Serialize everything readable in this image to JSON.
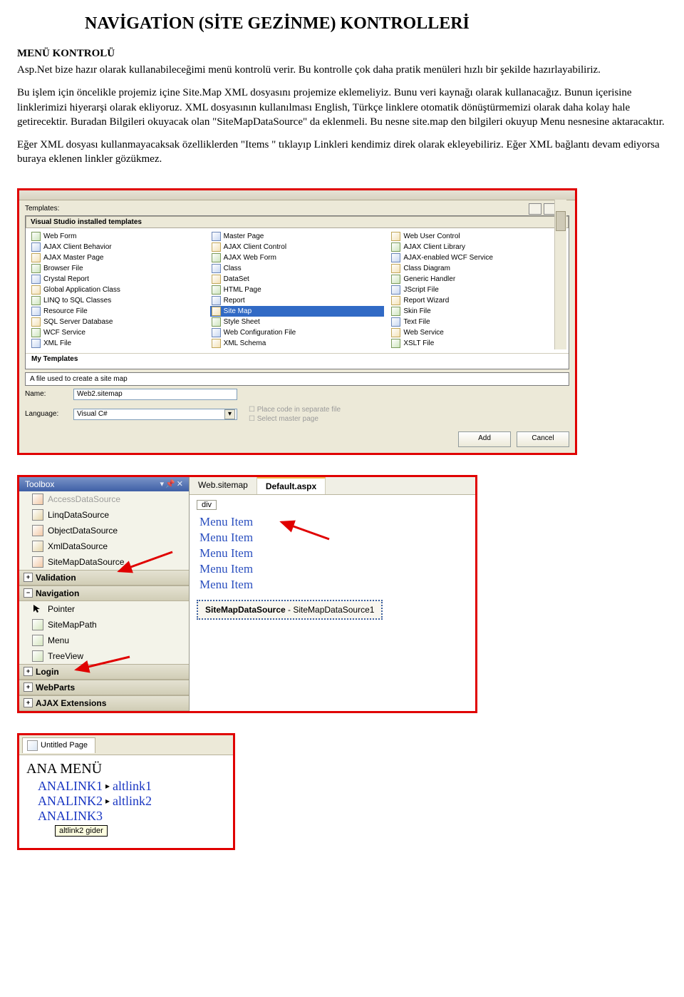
{
  "doc": {
    "title": "NAVİGATİON (SİTE GEZİNME) KONTROLLERİ",
    "subtitle": "MENÜ KONTROLÜ",
    "p1": "Asp.Net bize hazır olarak kullanabileceğimi menü kontrolü verir. Bu kontrolle çok daha pratik menüleri hızlı bir şekilde hazırlayabiliriz.",
    "p2": "Bu işlem için öncelikle projemiz içine Site.Map  XML dosyasını projemize eklemeliyiz. Bunu veri kaynağı olarak kullanacağız. Bunun içerisine linklerimizi hiyerarşi olarak ekliyoruz. XML dosyasının kullanılması English, Türkçe linklere otomatik dönüştürmemizi olarak daha kolay hale getirecektir. Buradan Bilgileri okuyacak olan \"SiteMapDataSource\" da eklenmeli. Bu nesne site.map den bilgileri okuyup Menu nesnesine aktaracaktır.",
    "p3": "Eğer XML dosyası kullanmayacaksak özelliklerden \"Items \" tıklayıp Linkleri kendimiz direk olarak ekleyebiliriz. Eğer XML bağlantı devam ediyorsa buraya eklenen linkler gözükmez."
  },
  "ss1": {
    "templates_label": "Templates:",
    "panel_head": "Visual Studio installed templates",
    "col1": [
      "Web Form",
      "AJAX Client Behavior",
      "AJAX Master Page",
      "Browser File",
      "Crystal Report",
      "Global Application Class",
      "LINQ to SQL Classes",
      "Resource File",
      "SQL Server Database",
      "WCF Service",
      "XML File"
    ],
    "col2": [
      "Master Page",
      "AJAX Client Control",
      "AJAX Web Form",
      "Class",
      "DataSet",
      "HTML Page",
      "Report",
      "Site Map",
      "Style Sheet",
      "Web Configuration File",
      "XML Schema"
    ],
    "col2_selected_index": 7,
    "col3": [
      "Web User Control",
      "AJAX Client Library",
      "AJAX-enabled WCF Service",
      "Class Diagram",
      "Generic Handler",
      "JScript File",
      "Report Wizard",
      "Skin File",
      "Text File",
      "Web Service",
      "XSLT File"
    ],
    "my_templates": "My Templates",
    "desc": "A file used to create a site map",
    "name_label": "Name:",
    "name_value": "Web2.sitemap",
    "lang_label": "Language:",
    "lang_value": "Visual C#",
    "chk1": "Place code in separate file",
    "chk2": "Select master page",
    "btn_add": "Add",
    "btn_cancel": "Cancel"
  },
  "ss2": {
    "toolbox_title": "Toolbox",
    "items_top": [
      "AccessDataSource",
      "LinqDataSource",
      "ObjectDataSource",
      "XmlDataSource",
      "SiteMapDataSource"
    ],
    "cat_validation": "Validation",
    "cat_navigation": "Navigation",
    "nav_items": [
      "Pointer",
      "SiteMapPath",
      "Menu",
      "TreeView"
    ],
    "cat_login": "Login",
    "cat_webparts": "WebParts",
    "cat_ajax": "AJAX Extensions",
    "tab_inactive": "Web.sitemap",
    "tab_active": "Default.aspx",
    "div_tag": "div",
    "menu_item": "Menu Item",
    "menu_item_count": 5,
    "smds_label": "SiteMapDataSource",
    "smds_id": " - SiteMapDataSource1"
  },
  "ss3": {
    "tab_title": "Untitled Page",
    "heading": "ANA MENÜ",
    "rows": [
      {
        "main": "ANALINK1",
        "sub": "altlink1"
      },
      {
        "main": "ANALINK2",
        "sub": "altlink2"
      },
      {
        "main": "ANALINK3",
        "sub": ""
      }
    ],
    "tooltip": "altlink2 gider"
  }
}
